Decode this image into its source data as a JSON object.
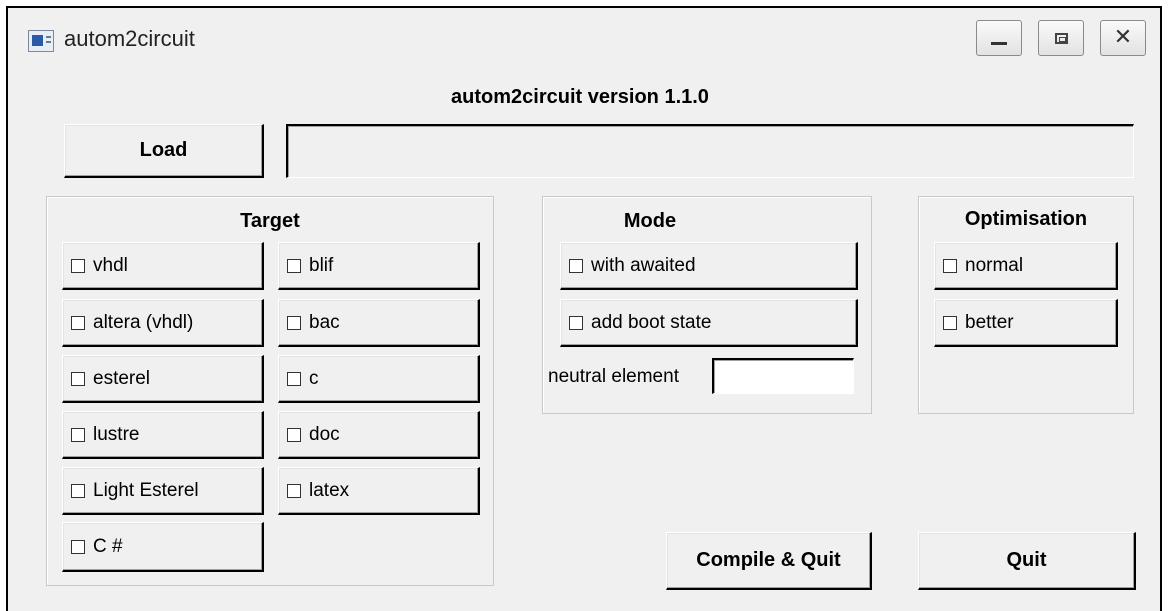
{
  "window": {
    "title": "autom2circuit",
    "controls": {
      "minimize": "minimize-icon",
      "maximize": "maximize-icon",
      "close": "close-icon"
    }
  },
  "header": {
    "version_text": "autom2circuit version 1.1.0"
  },
  "load": {
    "button_label": "Load",
    "path_value": ""
  },
  "target": {
    "heading": "Target",
    "options": [
      {
        "label": "vhdl",
        "checked": false
      },
      {
        "label": "blif",
        "checked": false
      },
      {
        "label": "altera (vhdl)",
        "checked": false
      },
      {
        "label": "bac",
        "checked": false
      },
      {
        "label": "esterel",
        "checked": false
      },
      {
        "label": "c",
        "checked": false
      },
      {
        "label": "lustre",
        "checked": false
      },
      {
        "label": "doc",
        "checked": false
      },
      {
        "label": "Light Esterel",
        "checked": false
      },
      {
        "label": "latex",
        "checked": false
      },
      {
        "label": "C #",
        "checked": false
      }
    ]
  },
  "mode": {
    "heading": "Mode",
    "options": [
      {
        "label": "with awaited",
        "checked": false
      },
      {
        "label": "add boot state",
        "checked": false
      }
    ],
    "neutral_label": "neutral element",
    "neutral_value": ""
  },
  "optimisation": {
    "heading": "Optimisation",
    "options": [
      {
        "label": "normal",
        "checked": false
      },
      {
        "label": "better",
        "checked": false
      }
    ]
  },
  "actions": {
    "compile_label": "Compile & Quit",
    "quit_label": "Quit"
  }
}
